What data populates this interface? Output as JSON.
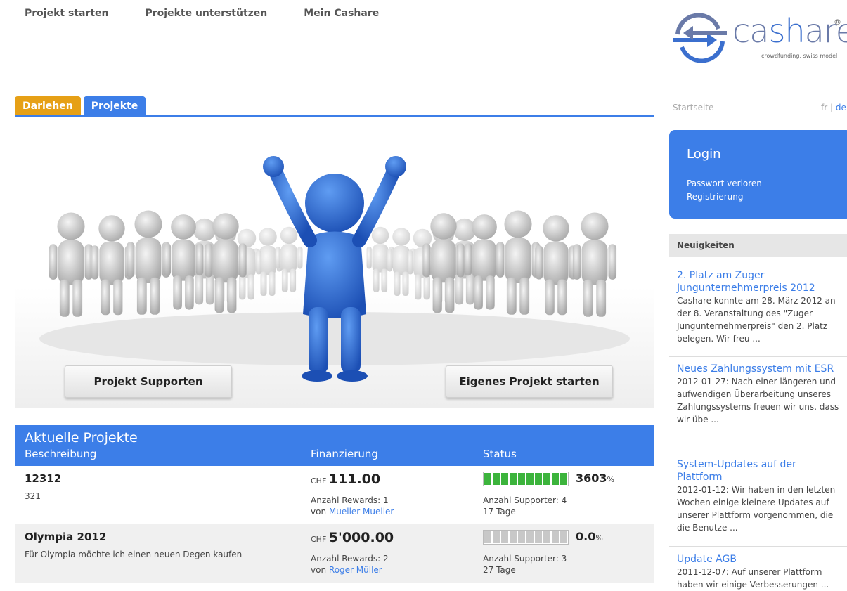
{
  "nav": [
    "Projekt starten",
    "Projekte unterstützen",
    "Mein Cashare"
  ],
  "logo": {
    "word_a": "ca",
    "word_b": "sh",
    "word_c": "are",
    "tagline": "crowdfunding, swiss model",
    "reg": "®"
  },
  "tabs": [
    "Darlehen",
    "Projekte"
  ],
  "breadcrumb": "Startseite",
  "lang": {
    "fr": "fr",
    "sep": " | ",
    "de": "de"
  },
  "hero": {
    "support_label": "Projekt Supporten",
    "own_label": "Eigenes Projekt starten"
  },
  "projects": {
    "title": "Aktuelle Projekte",
    "columns": [
      "Beschreibung",
      "Finanzierung",
      "Status"
    ],
    "rows": [
      {
        "name": "12312",
        "desc": "321",
        "currency": "CHF",
        "amount": "111.00",
        "rewards": "Anzahl Rewards: 1",
        "by_prefix": "von",
        "by": "Mueller Mueller",
        "progress_pct": "3603",
        "pct_sign": "%",
        "progress_fill": 1.0,
        "supporters": "Anzahl Supporter: 4",
        "days": "17 Tage"
      },
      {
        "name": "Olympia 2012",
        "desc": "Für Olympia möchte ich einen neuen Degen kaufen",
        "currency": "CHF",
        "amount": "5'000.00",
        "rewards": "Anzahl Rewards: 2",
        "by_prefix": "von",
        "by": "Roger Müller",
        "progress_pct": "0.0",
        "pct_sign": "%",
        "progress_fill": 0.0,
        "supporters": "Anzahl Supporter: 3",
        "days": "27 Tage"
      }
    ]
  },
  "login": {
    "title": "Login",
    "forgot": "Passwort verloren",
    "register": "Registrierung"
  },
  "news": {
    "header": "Neuigkeiten",
    "items": [
      {
        "title": "2. Platz am Zuger Jungunternehmerpreis 2012",
        "body": "Cashare konnte am 28. März 2012 an der 8. Veranstaltung des \"Zuger Jungunternehmerpreis\" den 2. Platz belegen. Wir freu ..."
      },
      {
        "title": "Neues Zahlungssystem mit ESR",
        "body": "2012-01-27: Nach einer längeren und aufwendigen Überarbeitung unseres Zahlungssystems freuen wir uns, dass wir übe ..."
      },
      {
        "title": "System-Updates auf der Plattform",
        "body": "2012-01-12: Wir haben in den letzten Wochen einige kleinere Updates auf unserer Plattform vorgenommen, die die Benutze ..."
      },
      {
        "title": "Update AGB",
        "body": "2011-12-07: Auf unserer Plattform haben wir einige Verbesserungen ..."
      }
    ]
  },
  "colors": {
    "accent_blue": "#3c7ee8",
    "tab_orange": "#e6a016",
    "progress_green": "#3cb43c",
    "progress_gray": "#c8c8c8"
  }
}
